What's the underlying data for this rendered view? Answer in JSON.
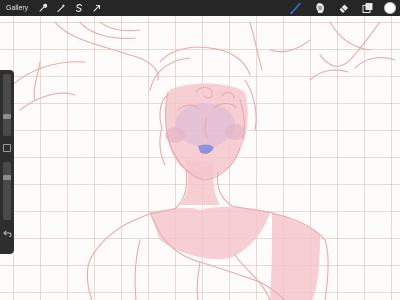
{
  "toolbar": {
    "gallery_label": "Gallery",
    "left_icons": [
      "wrench-icon",
      "magic-wand-icon",
      "selection-icon",
      "transform-arrow-icon"
    ],
    "right_icons": [
      "brush-icon",
      "smudge-icon",
      "eraser-icon",
      "layers-icon"
    ],
    "active_tool": "brush-icon",
    "active_color": "#ffffff",
    "accent": "#3d6cf0"
  },
  "sidebar": {
    "brush_size": 0.3,
    "brush_opacity": 0.75
  }
}
